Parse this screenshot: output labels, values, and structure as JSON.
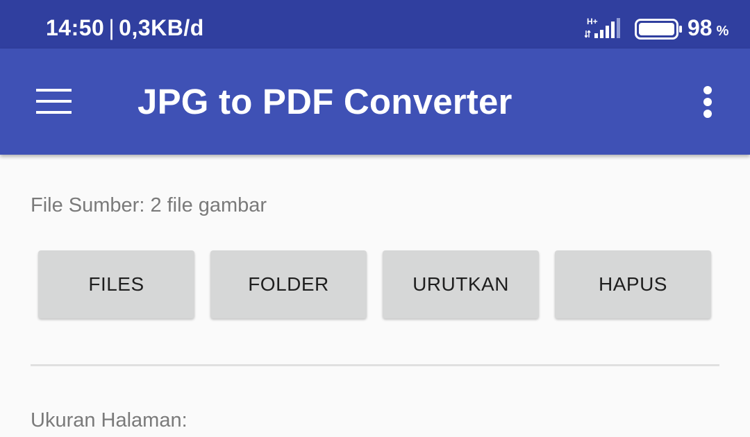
{
  "status_bar": {
    "time": "14:50",
    "separator": "|",
    "network_speed": "0,3KB/d",
    "network_type": "H+",
    "battery_level": "98",
    "battery_unit": "%",
    "icons": [
      "signal-icon",
      "battery-icon"
    ]
  },
  "app_bar": {
    "title": "JPG to PDF Converter",
    "icons": [
      "menu-icon",
      "overflow-menu-icon"
    ]
  },
  "content": {
    "source_label": "File Sumber: 2 file gambar",
    "buttons": {
      "files": "FILES",
      "folder": "FOLDER",
      "sort": "URUTKAN",
      "delete": "HAPUS"
    },
    "page_size_label": "Ukuran Halaman:"
  },
  "colors": {
    "status_bar": "#303f9f",
    "app_bar": "#3f51b5",
    "background": "#fafafa",
    "button": "#d6d7d7"
  }
}
